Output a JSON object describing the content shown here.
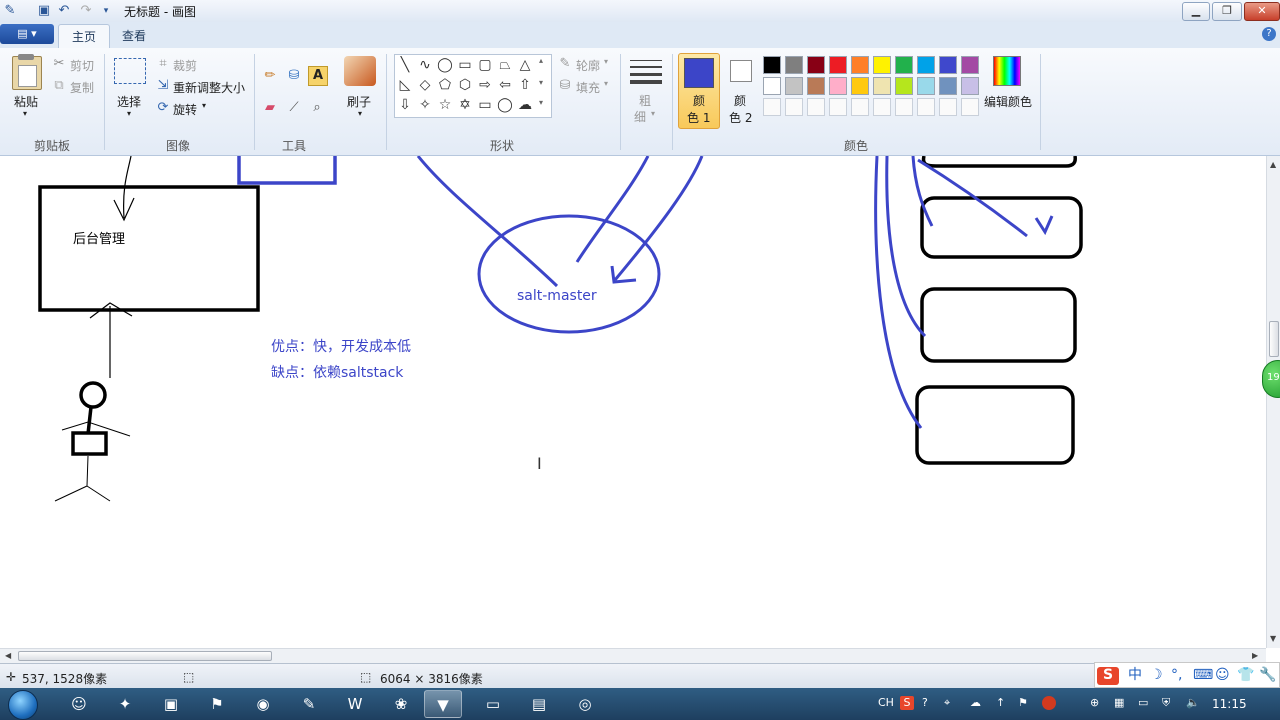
{
  "window": {
    "title": "无标题 - 画图"
  },
  "tabs": {
    "home": "主页",
    "view": "查看"
  },
  "clipboard": {
    "paste": "粘贴",
    "cut": "剪切",
    "copy": "复制",
    "group": "剪贴板"
  },
  "image": {
    "select": "选择",
    "crop": "裁剪",
    "resize": "重新调整大小",
    "rotate": "旋转",
    "group": "图像"
  },
  "tools": {
    "group": "工具",
    "brush": "刷子"
  },
  "shapes": {
    "outline": "轮廓",
    "fill": "填充",
    "group": "形状"
  },
  "size": {
    "line1": "粗",
    "line2": "细"
  },
  "colors": {
    "color1_line1": "颜",
    "color1_line2": "色 1",
    "color2_line1": "颜",
    "color2_line2": "色 2",
    "edit": "编辑颜色",
    "group": "颜色",
    "color1_value": "#3c45c8",
    "color2_value": "#ffffff",
    "palette": [
      "#000000",
      "#7f7f7f",
      "#880015",
      "#ed1c24",
      "#ff7f27",
      "#fff200",
      "#22b14c",
      "#00a2e8",
      "#3f48cc",
      "#a349a4",
      "#ffffff",
      "#c3c3c3",
      "#b97a57",
      "#ffaec9",
      "#ffc90e",
      "#efe4b0",
      "#b5e61d",
      "#99d9ea",
      "#7092be",
      "#c8bfe7"
    ]
  },
  "canvas": {
    "box_label": "后台管理",
    "ellipse_label": "salt-master",
    "pros": "优点：快，开发成本低",
    "cons": "缺点：依赖saltstack",
    "ink_color": "#3c45c8"
  },
  "status": {
    "cursor_pos": "537, 1528像素",
    "canvas_size": "6064 × 3816像素"
  },
  "taskbar": {
    "lang": "CH",
    "clock": "11:15"
  },
  "ime": {
    "mode": "中"
  },
  "side_badge": "19"
}
